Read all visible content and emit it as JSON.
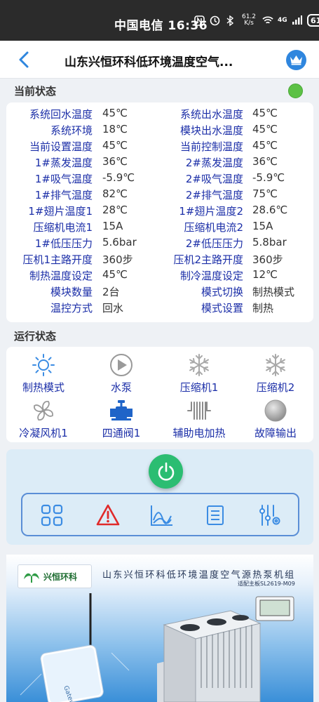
{
  "status_bar": {
    "carrier_time": "中国电信 16:36",
    "net_speed": "61.2 K/s",
    "net_type": "4G",
    "battery": "61"
  },
  "header": {
    "title": "山东兴恒环科低环境温度空气...",
    "back_icon": "chevron-left-icon",
    "vip_icon": "crown-icon"
  },
  "current_status": {
    "title": "当前状态",
    "indicator_color": "#5cc145",
    "rows": [
      {
        "l1": "系统回水温度",
        "v1": "45℃",
        "l2": "系统出水温度",
        "v2": "45℃"
      },
      {
        "l1": "系统环境",
        "v1": "18℃",
        "l2": "模块出水温度",
        "v2": "45℃"
      },
      {
        "l1": "当前设置温度",
        "v1": "45℃",
        "l2": "当前控制温度",
        "v2": "45℃"
      },
      {
        "l1": "1#蒸发温度",
        "v1": "36℃",
        "l2": "2#蒸发温度",
        "v2": "36℃"
      },
      {
        "l1": "1#吸气温度",
        "v1": "-5.9℃",
        "l2": "2#吸气温度",
        "v2": "-5.9℃"
      },
      {
        "l1": "1#排气温度",
        "v1": "82℃",
        "l2": "2#排气温度",
        "v2": "75℃"
      },
      {
        "l1": "1#翅片温度1",
        "v1": "28℃",
        "l2": "1#翅片温度2",
        "v2": "28.6℃"
      },
      {
        "l1": "压缩机电流1",
        "v1": "15A",
        "l2": "压缩机电流2",
        "v2": "15A"
      },
      {
        "l1": "1#低压压力",
        "v1": "5.6bar",
        "l2": "2#低压压力",
        "v2": "5.8bar"
      },
      {
        "l1": "压机1主路开度",
        "v1": "360步",
        "l2": "压机2主路开度",
        "v2": "360步"
      },
      {
        "l1": "制热温度设定",
        "v1": "45℃",
        "l2": "制冷温度设定",
        "v2": "12℃"
      },
      {
        "l1": "模块数量",
        "v1": "2台",
        "l2": "模式切换",
        "v2": "制热模式"
      },
      {
        "l1": "温控方式",
        "v1": "回水",
        "l2": "模式设置",
        "v2": "制热"
      }
    ]
  },
  "run_status": {
    "title": "运行状态",
    "items": [
      {
        "label": "制热模式",
        "icon": "sun-icon"
      },
      {
        "label": "水泵",
        "icon": "pump-icon"
      },
      {
        "label": "压缩机1",
        "icon": "snowflake-icon"
      },
      {
        "label": "压缩机2",
        "icon": "snowflake-icon"
      },
      {
        "label": "冷凝风机1",
        "icon": "fan-icon"
      },
      {
        "label": "四通阀1",
        "icon": "valve-icon"
      },
      {
        "label": "辅助电加热",
        "icon": "heater-icon"
      },
      {
        "label": "故障输出",
        "icon": "fault-icon"
      }
    ]
  },
  "controls": {
    "power_icon": "power-icon",
    "toolbar": [
      "grid-icon",
      "alarm-icon",
      "curve-chart-icon",
      "list-icon",
      "settings-sliders-icon"
    ]
  },
  "banner": {
    "logo_text": "兴恒环科",
    "title": "山东兴恒环科低环境温度空气源热泵机组",
    "subtitle": "适配主板SL2619-M09",
    "device_label": "Gateway"
  }
}
